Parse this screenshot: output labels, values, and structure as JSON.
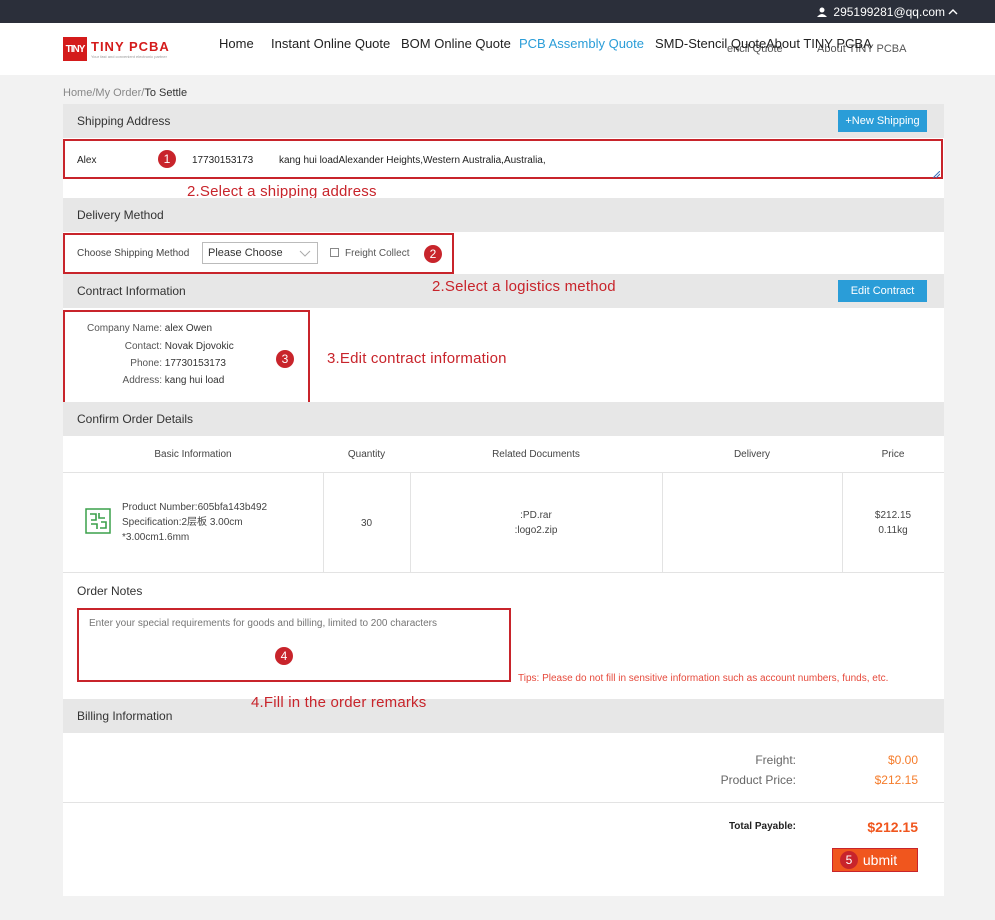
{
  "topbar": {
    "user_email": "295199281@qq.com",
    "caret": "^"
  },
  "header": {
    "logo_mark": "TINY",
    "logo_name": "TINY PCBA",
    "logo_tag": "Your fast and convenient electronic partner",
    "nav": [
      "Home",
      "Instant Online Quote",
      "BOM Online Quote",
      "PCB Assembly Quote",
      "SMD-Stencil Quote",
      "About TINY PCBA"
    ],
    "nav_ghost": [
      "encil Quote",
      "About TINY PCBA"
    ]
  },
  "breadcrumb": {
    "home": "Home",
    "sep1": "/",
    "order": "My Order",
    "sep2": "/",
    "current": "To Settle"
  },
  "shipping": {
    "title": "Shipping Address",
    "new_button": "+New Shipping",
    "name": "Alex",
    "phone": "17730153173",
    "address": "kang hui loadAlexander Heights,Western Australia,Australia,",
    "annotation": "2.Select a shipping address",
    "badge": "1"
  },
  "delivery": {
    "title": "Delivery Method",
    "choose_label": "Choose Shipping Method",
    "select_value": "Please Choose",
    "freight_label": "Freight Collect",
    "badge": "2",
    "annotation": "2.Select a logistics method"
  },
  "contract": {
    "title": "Contract Information",
    "edit_button": "Edit Contract",
    "rows": [
      {
        "k": "Company Name:",
        "v": "alex Owen"
      },
      {
        "k": "Contact:",
        "v": "Novak Djovokic"
      },
      {
        "k": "Phone:",
        "v": "17730153173"
      },
      {
        "k": "Address:",
        "v": "kang hui load"
      }
    ],
    "badge": "3",
    "annotation": "3.Edit contract information"
  },
  "order": {
    "title": "Confirm Order Details",
    "headers": [
      "Basic Information",
      "Quantity",
      "Related Documents",
      "Delivery",
      "Price"
    ],
    "product_number": "Product Number:605bfa143b492",
    "spec_line1": "Specification:2层板 3.00cm",
    "spec_line2": "*3.00cm1.6mm",
    "quantity": "30",
    "doc1": ":PD.rar",
    "doc2": ":logo2.zip",
    "delivery": "",
    "price": "$212.15",
    "weight": "0.11kg"
  },
  "notes": {
    "title": "Order Notes",
    "placeholder": "Enter your special requirements for goods and billing, limited to 200 characters",
    "tips": "Tips: Please do not fill in sensitive information such as account numbers, funds, etc.",
    "badge": "4",
    "annotation": "4.Fill in the order remarks"
  },
  "billing": {
    "title": "Billing Information",
    "freight_label": "Freight:",
    "freight_value": "$0.00",
    "product_label": "Product Price:",
    "product_value": "$212.15",
    "total_label": "Total Payable:",
    "total_value": "$212.15",
    "submit": "Submit",
    "submit_shown": "ubmit",
    "badge": "5"
  },
  "colors": {
    "accent_blue": "#2a9dd8",
    "annotation_red": "#c8242b",
    "price_orange": "#f57c2b",
    "submit_orange": "#f0561e"
  }
}
